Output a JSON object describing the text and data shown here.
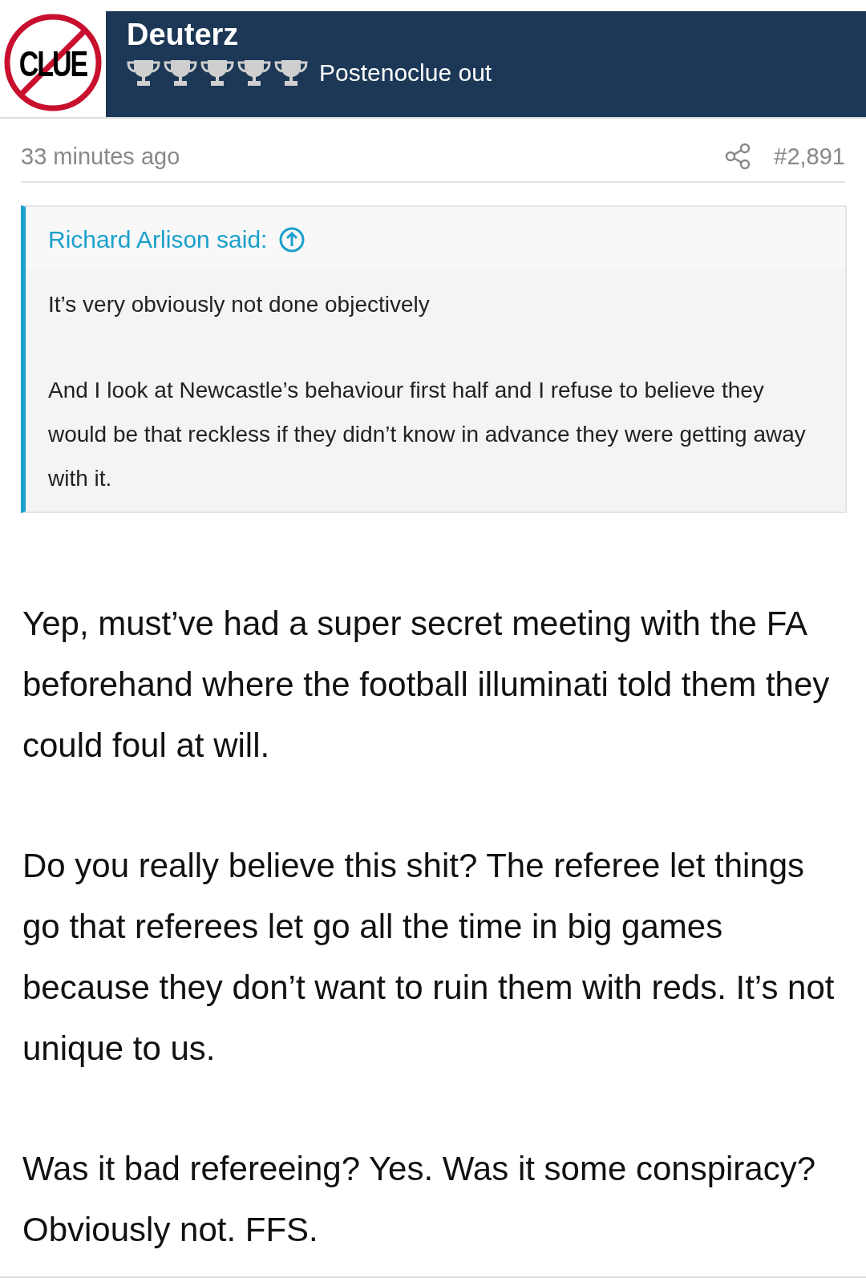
{
  "post": {
    "author": {
      "avatar_text": "CLUE",
      "name": "Deuterz",
      "stars": 5,
      "title": "Postenoclue out"
    },
    "time": "33 minutes ago",
    "number": "#2,891",
    "quote": {
      "attribution": "Richard Arlison said:",
      "paragraphs": [
        "It’s very obviously not done objectively",
        "And I look at Newcastle’s behaviour first half and I refuse to believe they would be that reckless if they didn’t know in advance they were getting away with it."
      ]
    },
    "paragraphs": [
      "Yep, must’ve had a super secret meeting with the FA beforehand where the football illuminati told them they could foul at will.",
      "Do you really believe this shit? The referee let things go that referees let go all the time in big games because they don’t want to ruin them with reds. It’s not unique to us.",
      "Was it bad refereeing? Yes. Was it some conspiracy? Obviously not. FFS."
    ]
  }
}
